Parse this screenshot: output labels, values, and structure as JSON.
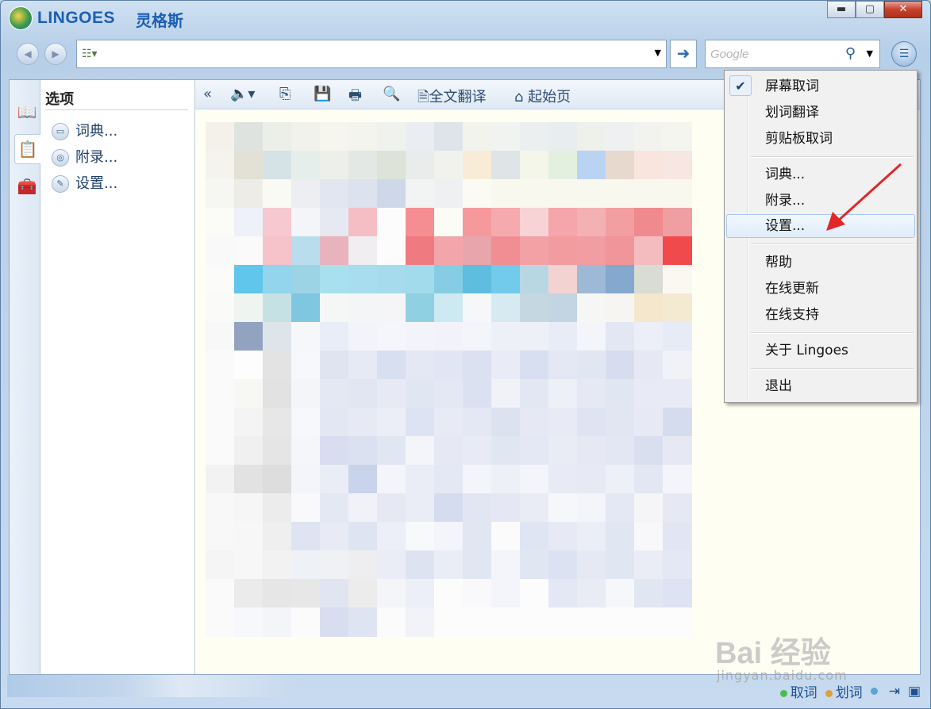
{
  "app": {
    "brand": "LINGOES",
    "brand_cn": "灵格斯"
  },
  "window_controls": {
    "minimize": "▬",
    "maximize": "▢",
    "close": "✕"
  },
  "toolbar": {
    "back_icon": "◀",
    "forward_icon": "▶",
    "address_value": "",
    "go_icon": "➜",
    "search_placeholder": "Google",
    "search_icon": "⚲",
    "menu_icon": "☰"
  },
  "left_tabs": [
    "dictionary-tab",
    "options-tab",
    "appendix-tab"
  ],
  "options_panel": {
    "title": "选项",
    "items": [
      {
        "label": "词典...",
        "icon": "📖"
      },
      {
        "label": "附录...",
        "icon": "◎"
      },
      {
        "label": "设置...",
        "icon": "🔧"
      }
    ]
  },
  "main_toolbar": {
    "collapse": "«",
    "sound": "🔈▾",
    "copy": "⎘",
    "save": "💾",
    "print": "🖶",
    "find": "🔍",
    "translate_label": "全文翻译",
    "home_label": "起始页"
  },
  "menu": {
    "items": [
      {
        "label": "屏幕取词",
        "checked": true
      },
      {
        "label": "划词翻译"
      },
      {
        "label": "剪贴板取词"
      },
      {
        "label": "词典..."
      },
      {
        "label": "附录..."
      },
      {
        "label": "设置...",
        "hover": true
      },
      {
        "label": "帮助"
      },
      {
        "label": "在线更新"
      },
      {
        "label": "在线支持"
      },
      {
        "label": "关于 Lingoes"
      },
      {
        "label": "退出"
      }
    ]
  },
  "statusbar": {
    "capture_label": "取词",
    "select_label": "划词",
    "capture_color": "#4cbc4c",
    "select_color": "#d9a23a"
  },
  "watermark": {
    "main": "Bai 经验",
    "sub": "jingyan.baidu.com"
  }
}
